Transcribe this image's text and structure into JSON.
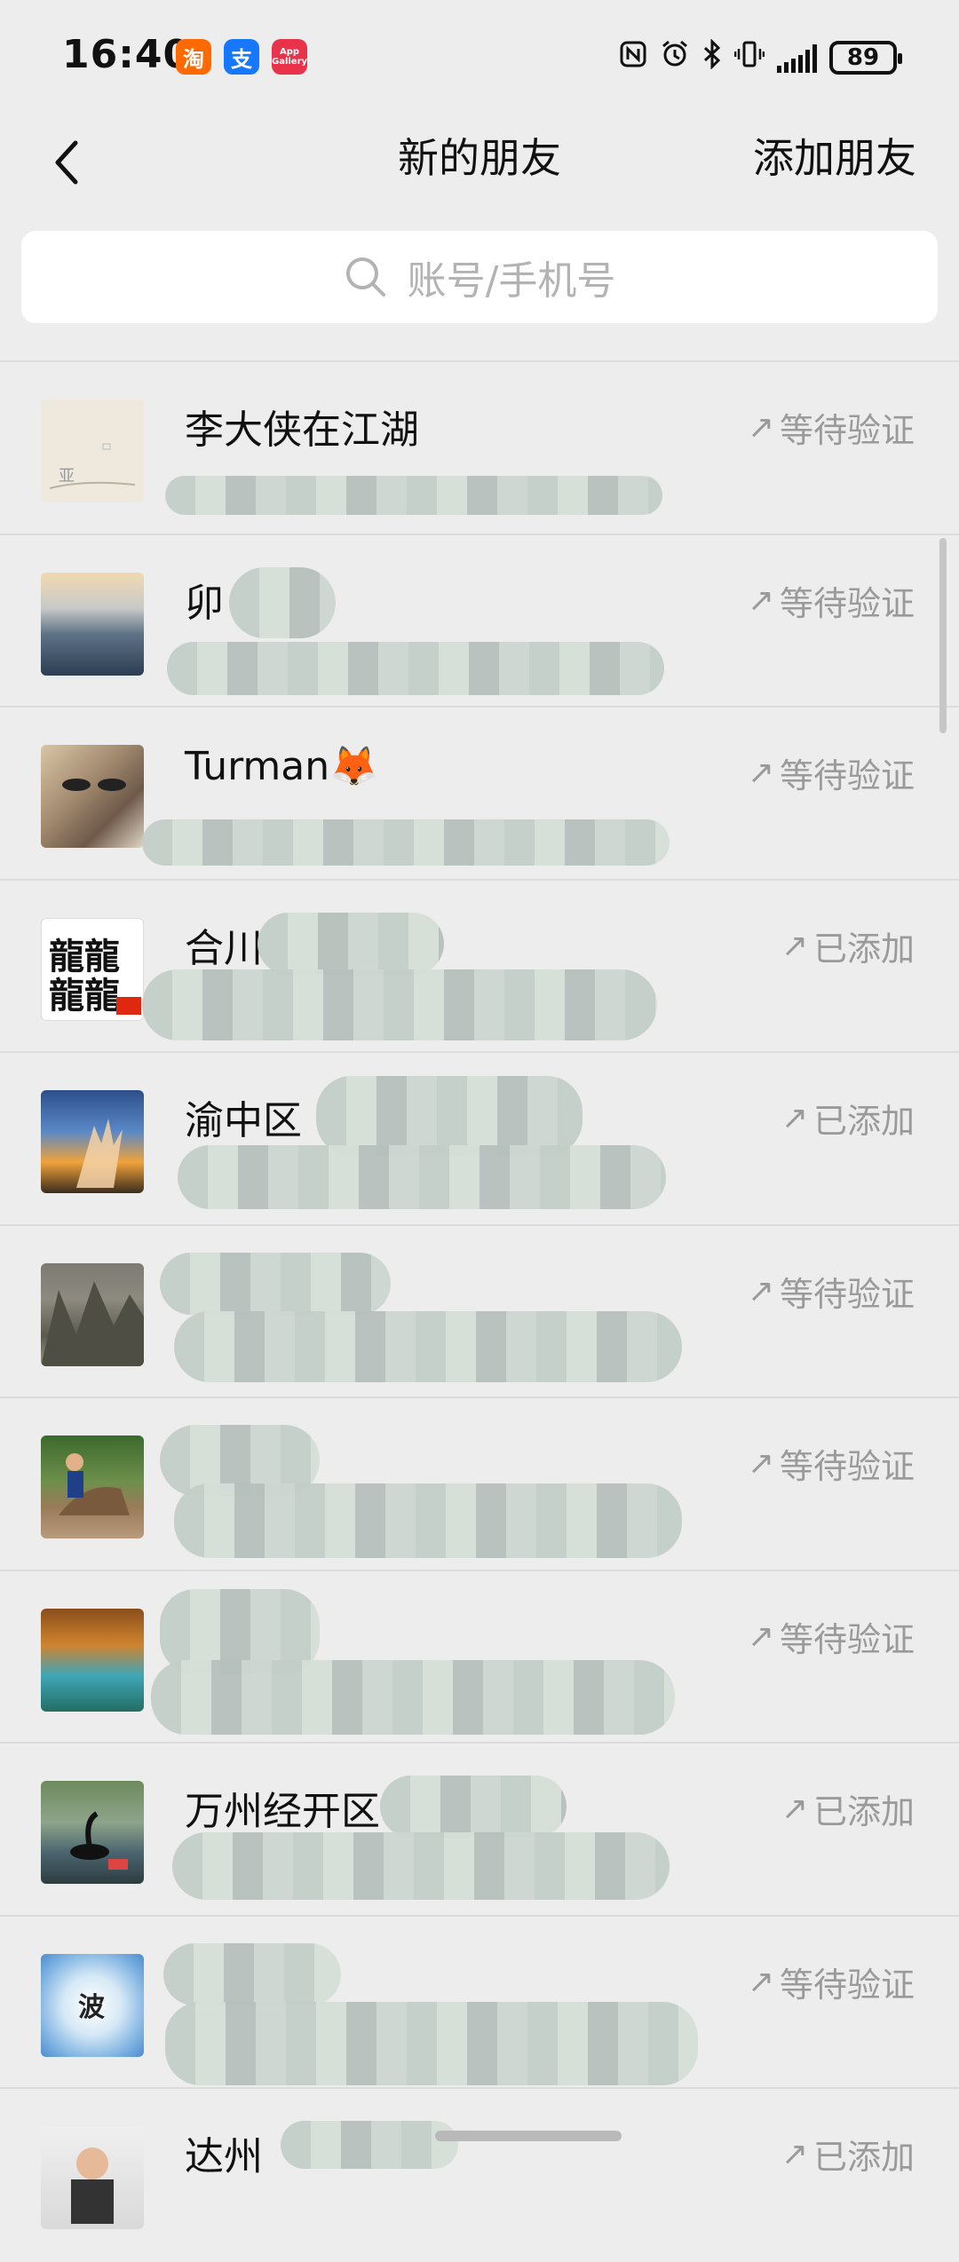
{
  "status_bar": {
    "time": "16:40",
    "apps": [
      {
        "name": "taobao-app-icon",
        "glyph": "淘"
      },
      {
        "name": "alipay-app-icon",
        "glyph": "支"
      },
      {
        "name": "app-gallery-icon",
        "glyph": "App Gallery"
      }
    ],
    "battery_level": "89"
  },
  "nav": {
    "title": "新的朋友",
    "action": "添加朋友"
  },
  "search": {
    "placeholder": "账号/手机号"
  },
  "friends": [
    {
      "name": "李大侠在江湖",
      "status": "等待验证"
    },
    {
      "name": "卯",
      "status": "等待验证"
    },
    {
      "name": "Turman🦊",
      "status": "等待验证"
    },
    {
      "name": "合川",
      "status": "已添加"
    },
    {
      "name": "渝中区",
      "status": "已添加"
    },
    {
      "name": "",
      "status": "等待验证"
    },
    {
      "name": "",
      "status": "等待验证"
    },
    {
      "name": "",
      "status": "等待验证"
    },
    {
      "name": "万州经开区",
      "status": "已添加"
    },
    {
      "name": "",
      "status": "等待验证"
    },
    {
      "name": "达州",
      "status": "已添加"
    }
  ],
  "colors": {
    "background": "#ededed",
    "status_text": "#9a9a9a",
    "accent_taobao": "#ff6a00",
    "accent_alipay": "#1677ff"
  }
}
